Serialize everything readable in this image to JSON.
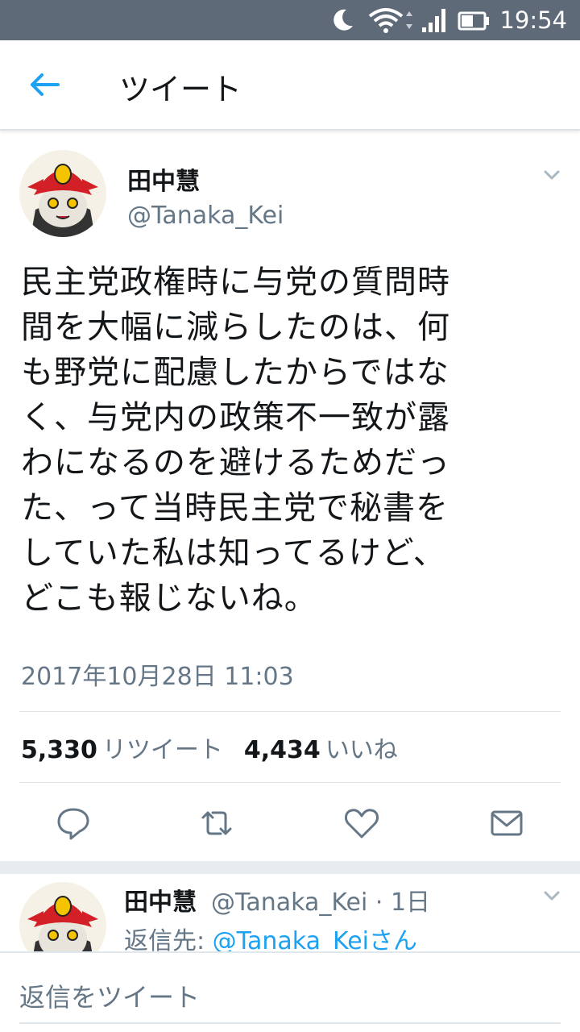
{
  "status_bar": {
    "time": "19:54"
  },
  "header": {
    "title": "ツイート"
  },
  "tweet": {
    "author_name": "田中慧",
    "author_handle": "@Tanaka_Kei",
    "text_lines": [
      "民主党政権時に与党の質問時",
      "間を大幅に減らしたのは、何",
      "も野党に配慮したからではな",
      "く、与党内の政策不一致が露",
      "わになるのを避けるためだっ",
      "た、って当時民主党で秘書を",
      "していた私は知ってるけど、",
      "どこも報じないね。"
    ],
    "timestamp": "2017年10月28日 11:03",
    "retweet_count": "5,330",
    "retweet_label": "リツイート",
    "like_count": "4,434",
    "like_label": "いいね"
  },
  "reply": {
    "author_name": "田中慧",
    "author_meta": "@Tanaka_Kei · 1日",
    "reply_to_prefix": "返信先: ",
    "reply_to_link": "@Tanaka_Keiさん"
  },
  "compose": {
    "placeholder": "返信をツイート"
  },
  "colors": {
    "accent": "#1da1f2",
    "status_bar": "#5f6a78",
    "secondary_text": "#657786"
  }
}
